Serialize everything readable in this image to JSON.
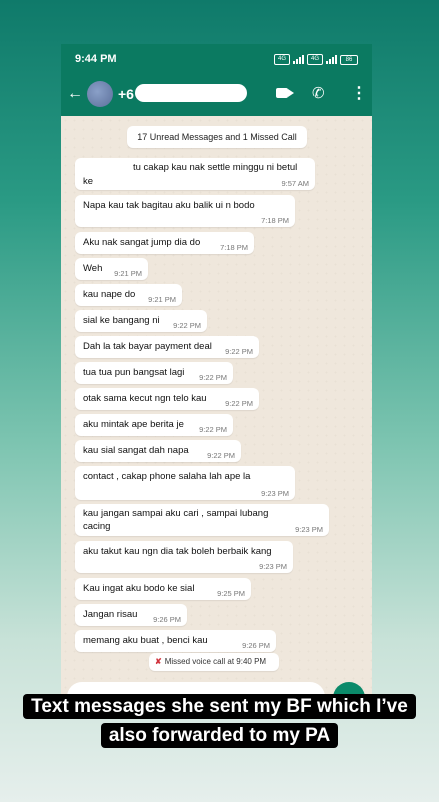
{
  "status_bar": {
    "time": "9:44 PM",
    "network_left": "4G",
    "network_right": "4G",
    "battery": "86"
  },
  "header": {
    "contact_prefix": "+6"
  },
  "banner": "17 Unread Messages and 1 Missed Call",
  "messages": [
    {
      "text1": "tu cakap kau nak settle minggu ni betul",
      "text2": "ke",
      "time": "9:57 AM"
    },
    {
      "text1": "Napa kau tak bagitau aku       balik ui  n bodo",
      "time": "7:18 PM"
    },
    {
      "text1": "Aku nak sangat jump dia do",
      "time": "7:18 PM"
    },
    {
      "text1": "Weh",
      "time": "9:21 PM"
    },
    {
      "text1": "kau nape do",
      "time": "9:21 PM"
    },
    {
      "text1": "sial ke bangang ni",
      "time": "9:22 PM"
    },
    {
      "text1": "Dah la tak bayar payment deal",
      "time": "9:22 PM"
    },
    {
      "text1": "tua tua pun bangsat lagi",
      "time": "9:22 PM"
    },
    {
      "text1": "otak sama kecut ngn telo kau",
      "time": "9:22 PM"
    },
    {
      "text1": "aku mintak ape berita je",
      "time": "9:22 PM"
    },
    {
      "text1": "kau sial sangat dah napa",
      "time": "9:22 PM"
    },
    {
      "text1": "contact    ,  cakap phone salaha lah ape la",
      "time": "9:23 PM"
    },
    {
      "text1": "kau jangan sampai aku cari    ,  sampai lubang",
      "text2": "cacing",
      "time": "9:23 PM"
    },
    {
      "text1": "aku takut kau ngn dia tak boleh berbaik kang",
      "time": "9:23 PM"
    },
    {
      "text1": "Kau ingat aku bodo ke sial",
      "time": "9:25 PM"
    },
    {
      "text1": "Jangan risau",
      "time": "9:26 PM"
    },
    {
      "text1": "memang aku buat   ,  benci kau",
      "time": "9:26 PM"
    }
  ],
  "missed_call": "Missed voice call at 9:40 PM",
  "caption": "Text messages she sent my BF which I’ve also forwarded to my PA"
}
